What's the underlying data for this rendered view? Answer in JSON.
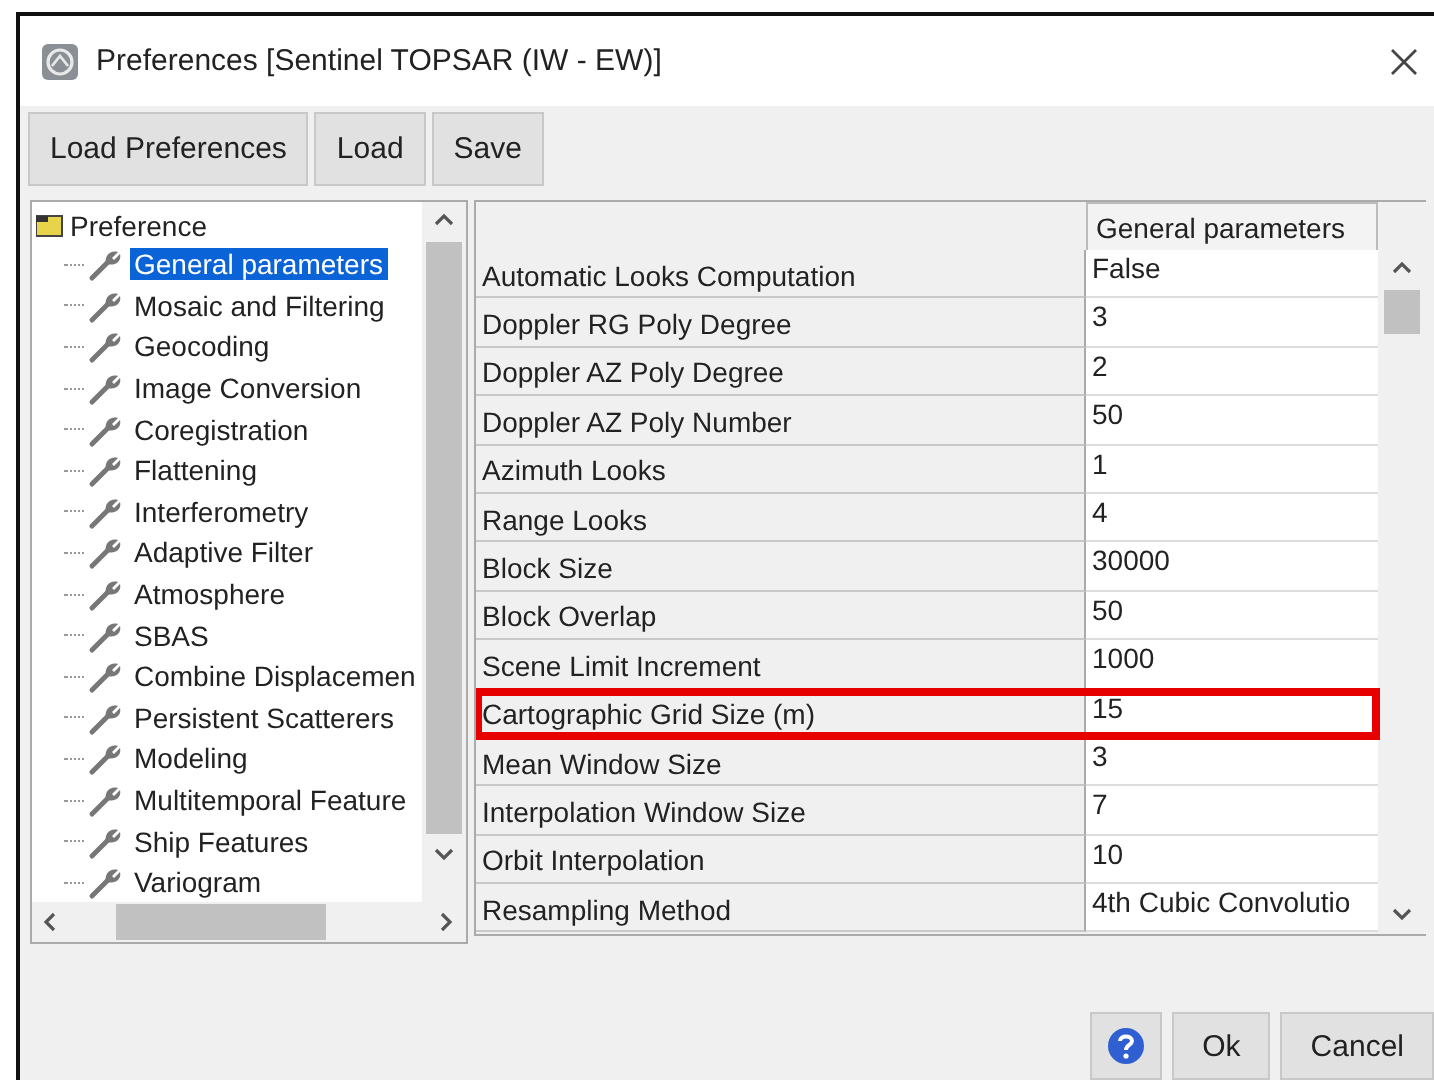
{
  "window": {
    "title": "Preferences [Sentinel TOPSAR (IW - EW)]"
  },
  "toolbar": [
    "Load Preferences",
    "Load",
    "Save"
  ],
  "tree": {
    "root": "Preference",
    "items": [
      {
        "label": "General parameters",
        "selected": true
      },
      {
        "label": "Mosaic and Filtering",
        "selected": false
      },
      {
        "label": "Geocoding",
        "selected": false
      },
      {
        "label": "Image Conversion",
        "selected": false
      },
      {
        "label": "Coregistration",
        "selected": false
      },
      {
        "label": "Flattening",
        "selected": false
      },
      {
        "label": "Interferometry",
        "selected": false
      },
      {
        "label": "Adaptive Filter",
        "selected": false
      },
      {
        "label": "Atmosphere",
        "selected": false
      },
      {
        "label": "SBAS",
        "selected": false
      },
      {
        "label": "Combine Displacemen",
        "selected": false
      },
      {
        "label": "Persistent Scatterers",
        "selected": false
      },
      {
        "label": "Modeling",
        "selected": false
      },
      {
        "label": "Multitemporal Feature",
        "selected": false
      },
      {
        "label": "Ship Features",
        "selected": false
      },
      {
        "label": "Variogram",
        "selected": false
      }
    ]
  },
  "table": {
    "column": "General parameters",
    "rows": [
      {
        "name": "Automatic Looks Computation",
        "value": "False",
        "highlighted": false
      },
      {
        "name": "Doppler RG Poly Degree",
        "value": "3",
        "highlighted": false
      },
      {
        "name": "Doppler AZ Poly Degree",
        "value": "2",
        "highlighted": false
      },
      {
        "name": "Doppler AZ Poly Number",
        "value": "50",
        "highlighted": false
      },
      {
        "name": "Azimuth Looks",
        "value": "1",
        "highlighted": false
      },
      {
        "name": "Range Looks",
        "value": "4",
        "highlighted": false
      },
      {
        "name": "Block Size",
        "value": "30000",
        "highlighted": false
      },
      {
        "name": "Block Overlap",
        "value": "50",
        "highlighted": false
      },
      {
        "name": "Scene Limit Increment",
        "value": "1000",
        "highlighted": false
      },
      {
        "name": "Cartographic Grid Size (m)",
        "value": "15",
        "highlighted": true
      },
      {
        "name": "Mean Window Size",
        "value": "3",
        "highlighted": false
      },
      {
        "name": "Interpolation Window Size",
        "value": "7",
        "highlighted": false
      },
      {
        "name": "Orbit Interpolation",
        "value": "10",
        "highlighted": false
      },
      {
        "name": "Resampling Method",
        "value": "4th Cubic Convolutio",
        "highlighted": false
      }
    ]
  },
  "footer": {
    "buttons": [
      "Ok",
      "Cancel"
    ]
  }
}
